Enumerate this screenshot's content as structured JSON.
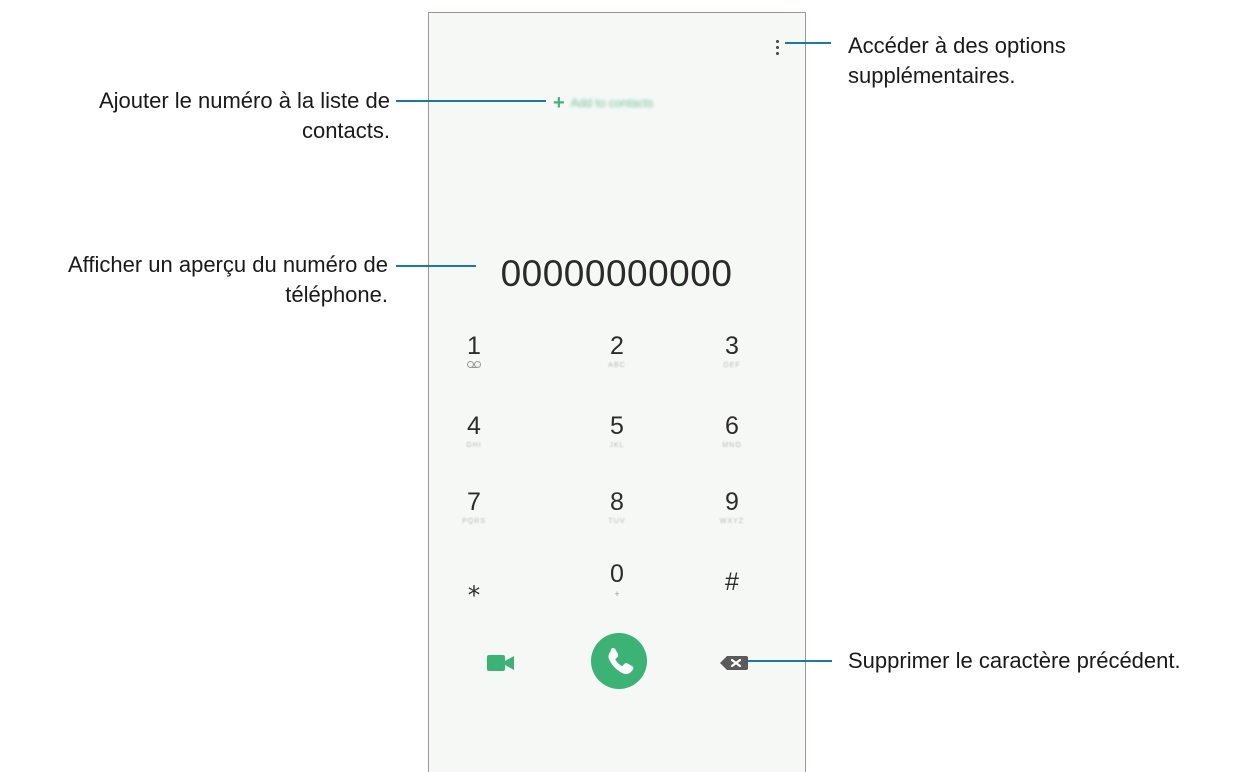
{
  "dialer": {
    "add_contacts_label": "Add to contacts",
    "add_contacts_icon": "+",
    "number_display": "00000000000",
    "keys": [
      {
        "digit": "1",
        "sub": ""
      },
      {
        "digit": "2",
        "sub": "ABC"
      },
      {
        "digit": "3",
        "sub": "DEF"
      },
      {
        "digit": "4",
        "sub": "GHI"
      },
      {
        "digit": "5",
        "sub": "JKL"
      },
      {
        "digit": "6",
        "sub": "MNO"
      },
      {
        "digit": "7",
        "sub": "PQRS"
      },
      {
        "digit": "8",
        "sub": "TUV"
      },
      {
        "digit": "9",
        "sub": "WXYZ"
      },
      {
        "digit": "⁎",
        "sub": ""
      },
      {
        "digit": "0",
        "sub": "+"
      },
      {
        "digit": "#",
        "sub": ""
      }
    ],
    "icons": {
      "more": "more-options-icon",
      "voicemail": "voicemail-icon",
      "video": "video-call-icon",
      "call": "phone-call-icon",
      "backspace": "backspace-icon"
    },
    "accent_color": "#3bb374"
  },
  "callouts": {
    "add_contact": "Ajouter le numéro à la liste de contacts.",
    "add_contact_line1": "Ajouter le numéro à la liste de",
    "add_contact_line2": "contacts.",
    "preview_line1": "Afficher un aperçu du numéro de",
    "preview_line2": "téléphone.",
    "options_line1": "Accéder à des options",
    "options_line2": "supplémentaires.",
    "delete": "Supprimer le caractère précédent.",
    "line_color": "#1779b0"
  }
}
